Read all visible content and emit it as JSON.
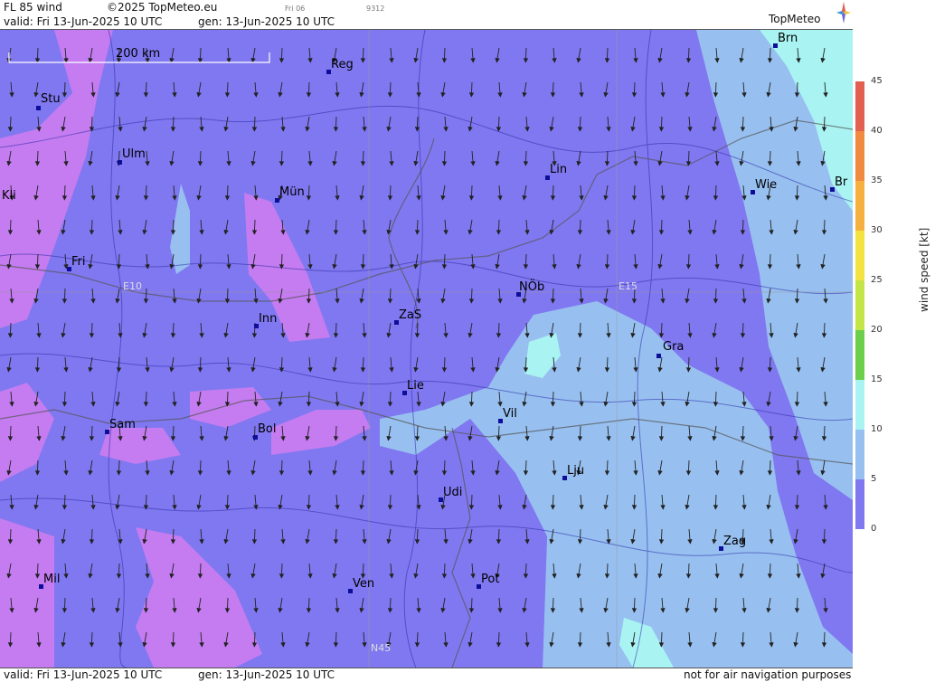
{
  "header": {
    "product": "FL 85 wind",
    "copyright": "©2025 TopMeteo.eu",
    "run": "Fri 06",
    "code": "9312",
    "valid": "valid:  Fri  13-Jun-2025  10 UTC",
    "generated": "gen: 13-Jun-2025 10 UTC",
    "logo": "TopMeteo"
  },
  "footer": {
    "valid": "valid:  Fri  13-Jun-2025  10 UTC",
    "generated": "gen: 13-Jun-2025 10 UTC",
    "disclaimer": "not for air navigation purposes"
  },
  "map": {
    "scale_label": "200 km",
    "grid_labels": [
      "E10",
      "E15",
      "N45"
    ],
    "wind_direction": "from north",
    "cities": [
      {
        "name": "Brn"
      },
      {
        "name": "Reg"
      },
      {
        "name": "Stu"
      },
      {
        "name": "Ulm"
      },
      {
        "name": "Lin"
      },
      {
        "name": "Wie"
      },
      {
        "name": "Br"
      },
      {
        "name": "Kli"
      },
      {
        "name": "Mün"
      },
      {
        "name": "Fri"
      },
      {
        "name": "NÖb"
      },
      {
        "name": "Inn"
      },
      {
        "name": "ZaS"
      },
      {
        "name": "Gra"
      },
      {
        "name": "Lie"
      },
      {
        "name": "Vil"
      },
      {
        "name": "Sam"
      },
      {
        "name": "Bol"
      },
      {
        "name": "Lju"
      },
      {
        "name": "Udi"
      },
      {
        "name": "Zag"
      },
      {
        "name": "Mil"
      },
      {
        "name": "Ven"
      },
      {
        "name": "Pot"
      }
    ]
  },
  "legend": {
    "title": "wind  speed  [kt]",
    "unit": "kt",
    "ticks": [
      "45",
      "40",
      "35",
      "30",
      "25",
      "20",
      "15",
      "10",
      "5",
      "0"
    ],
    "colors": [
      "#e2604f",
      "#f08a40",
      "#f6b040",
      "#f3e23f",
      "#c4e548",
      "#6ccf4c",
      "#a9f4f2",
      "#97c0f0",
      "#8078f0",
      "#c47cf0"
    ]
  }
}
